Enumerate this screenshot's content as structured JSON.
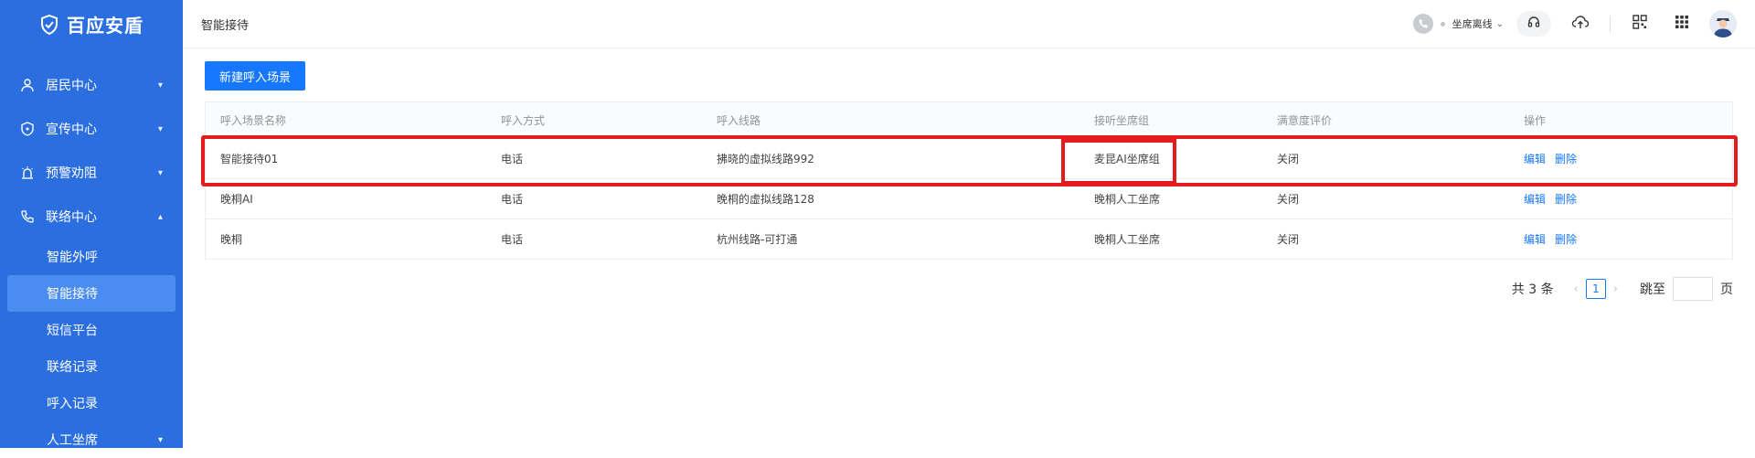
{
  "brand": {
    "name": "百应安盾"
  },
  "sidebar": {
    "items": [
      {
        "label": "居民中心",
        "icon": "user-icon",
        "expanded": false
      },
      {
        "label": "宣传中心",
        "icon": "shield-icon",
        "expanded": false
      },
      {
        "label": "预警劝阻",
        "icon": "alarm-icon",
        "expanded": false
      },
      {
        "label": "联络中心",
        "icon": "phone-icon",
        "expanded": true
      }
    ],
    "sub_items": [
      {
        "label": "智能外呼",
        "active": false
      },
      {
        "label": "智能接待",
        "active": true
      },
      {
        "label": "短信平台",
        "active": false
      },
      {
        "label": "联络记录",
        "active": false
      },
      {
        "label": "呼入记录",
        "active": false
      },
      {
        "label": "人工坐席",
        "active": false,
        "has_caret": true
      }
    ]
  },
  "header": {
    "title": "智能接待",
    "status_label": "坐席离线"
  },
  "main": {
    "new_button": "新建呼入场景",
    "table": {
      "columns": [
        "呼入场景名称",
        "呼入方式",
        "呼入线路",
        "接听坐席组",
        "满意度评价",
        "操作"
      ],
      "rows": [
        {
          "name": "智能接待01",
          "method": "电话",
          "line": "拂晓的虚拟线路992",
          "group": "麦昆AI坐席组",
          "rating": "关闭",
          "edit": "编辑",
          "delete": "删除"
        },
        {
          "name": "晚桐AI",
          "method": "电话",
          "line": "晚桐的虚拟线路128",
          "group": "晚桐人工坐席",
          "rating": "关闭",
          "edit": "编辑",
          "delete": "删除"
        },
        {
          "name": "晚桐",
          "method": "电话",
          "line": "杭州线路-可打通",
          "group": "晚桐人工坐席",
          "rating": "关闭",
          "edit": "编辑",
          "delete": "删除"
        }
      ]
    },
    "pagination": {
      "total": "共 3 条",
      "current_page": "1",
      "jump_label": "跳至",
      "jump_unit": "页"
    }
  },
  "colors": {
    "sidebar_bg": "#2b6ee0",
    "active_item_bg": "#4b8cf0",
    "primary": "#1677ff",
    "highlight": "#e51c1c"
  }
}
